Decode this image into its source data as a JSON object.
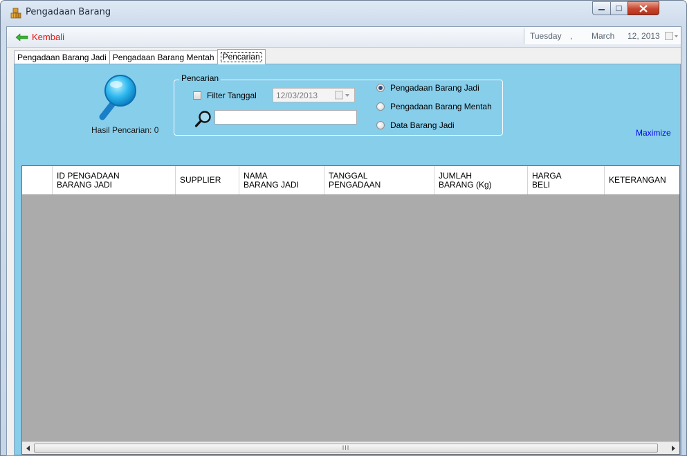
{
  "window": {
    "title": "Pengadaan Barang",
    "icon": "boxes-icon"
  },
  "toolbar": {
    "back_label": "Kembali",
    "date": {
      "day": "Tuesday",
      "sep": ",",
      "month": "March",
      "day_year": "12, 2013"
    }
  },
  "tabs": [
    {
      "label": "Pengadaan Barang Jadi",
      "active": false
    },
    {
      "label": "Pengadaan Barang Mentah",
      "active": false
    },
    {
      "label": "Pencarian",
      "active": true
    }
  ],
  "search": {
    "result_label": "Hasil Pencarian: 0",
    "group_label": "Pencarian",
    "filter_label": "Filter Tanggal",
    "filter_checked": false,
    "date_value": "12/03/2013",
    "query_value": "",
    "options": [
      {
        "label": "Pengadaan Barang Jadi",
        "checked": true
      },
      {
        "label": "Pengadaan Barang Mentah",
        "checked": false
      },
      {
        "label": "Data Barang Jadi",
        "checked": false
      }
    ],
    "maximize_label": "Maximize"
  },
  "grid": {
    "columns": [
      "ID PENGADAAN\nBARANG JADI",
      "SUPPLIER",
      "NAMA\nBARANG JADI",
      "TANGGAL\nPENGADAAN",
      "JUMLAH\nBARANG (Kg)",
      "HARGA\nBELI",
      "KETERANGAN"
    ],
    "rows": [],
    "scroll_grip": "III"
  },
  "colors": {
    "panel_bg": "#87ceeb",
    "grid_bg": "#ababab",
    "back_text": "#e01010",
    "link": "#0000ee"
  }
}
